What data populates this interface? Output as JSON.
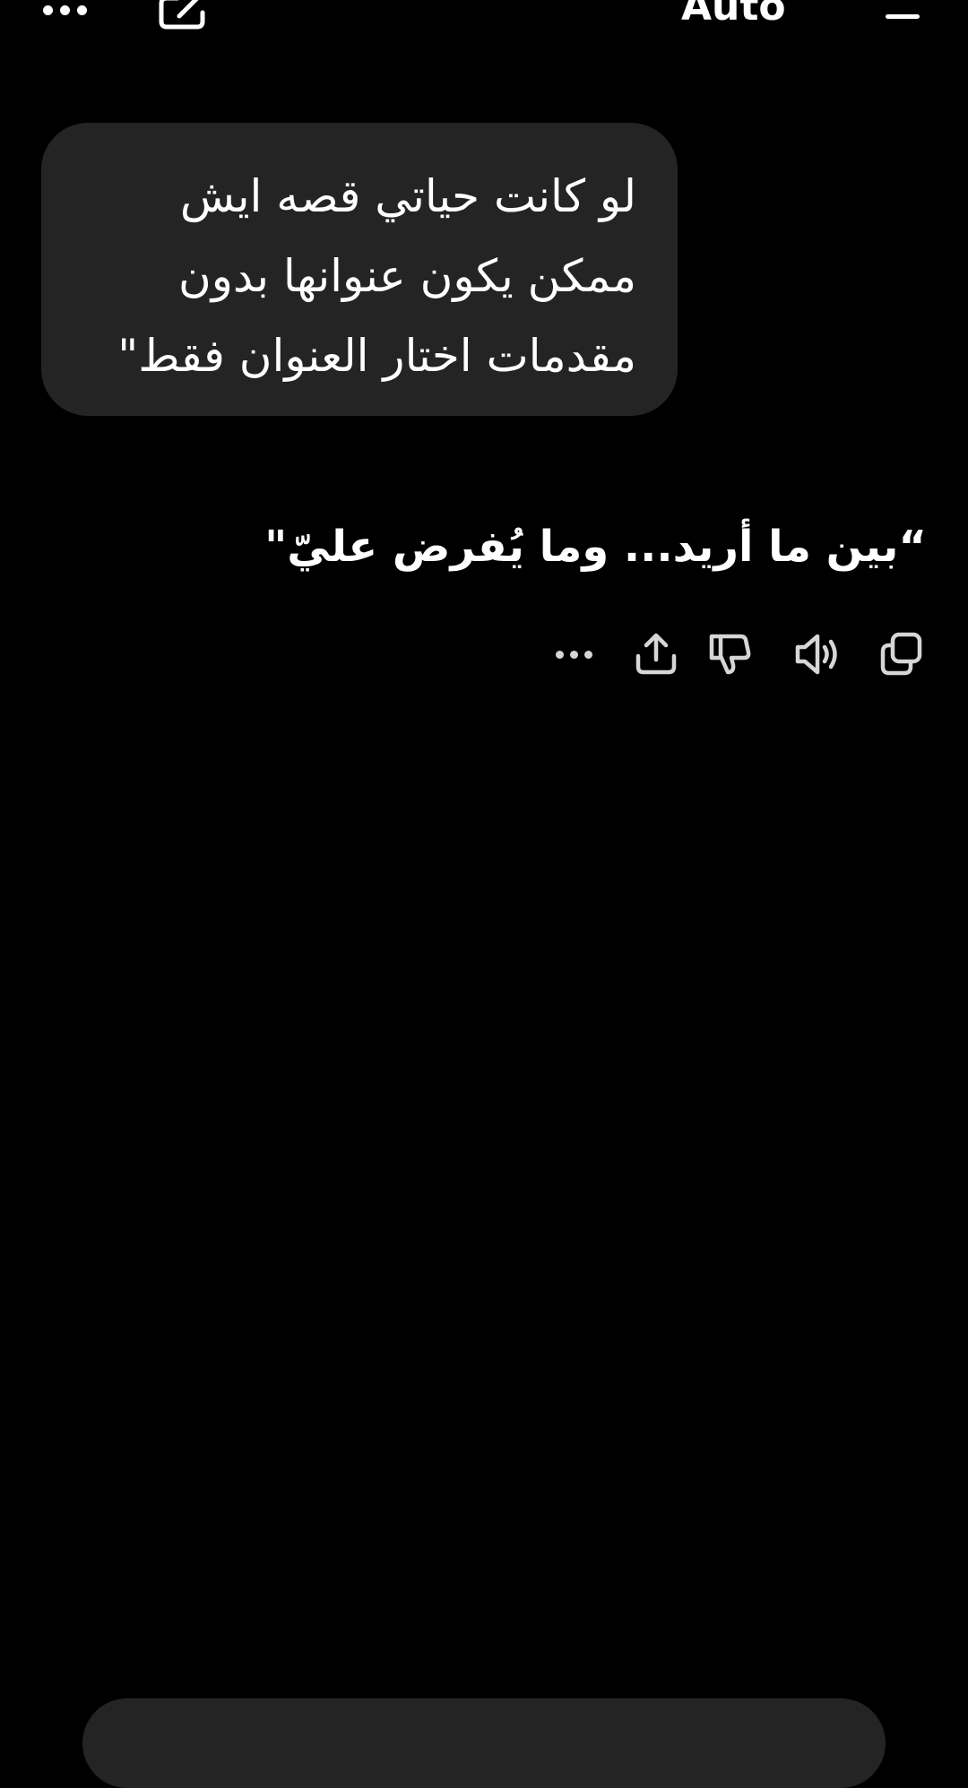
{
  "header": {
    "model_label": "Auto",
    "icons": {
      "more": "more-horizontal-icon",
      "edit": "new-chat-edit-icon",
      "menu": "menu-icon"
    }
  },
  "conversation": {
    "user_message": {
      "lines": [
        "لو كانت حياتي قصه ايش",
        "ممكن يكون عنوانها بدون",
        "مقدمات اختار العنوان فقط\""
      ]
    },
    "assistant_message": {
      "text": "“بين ما أريد... وما يُفرض عليّ\""
    },
    "action_icons": [
      "copy-icon",
      "read-aloud-icon",
      "thumbs-down-icon",
      "share-icon",
      "more-icon"
    ]
  },
  "colors": {
    "background": "#000000",
    "bubble": "#242424",
    "text": "#ffffff",
    "icon": "#d6d6d6"
  }
}
